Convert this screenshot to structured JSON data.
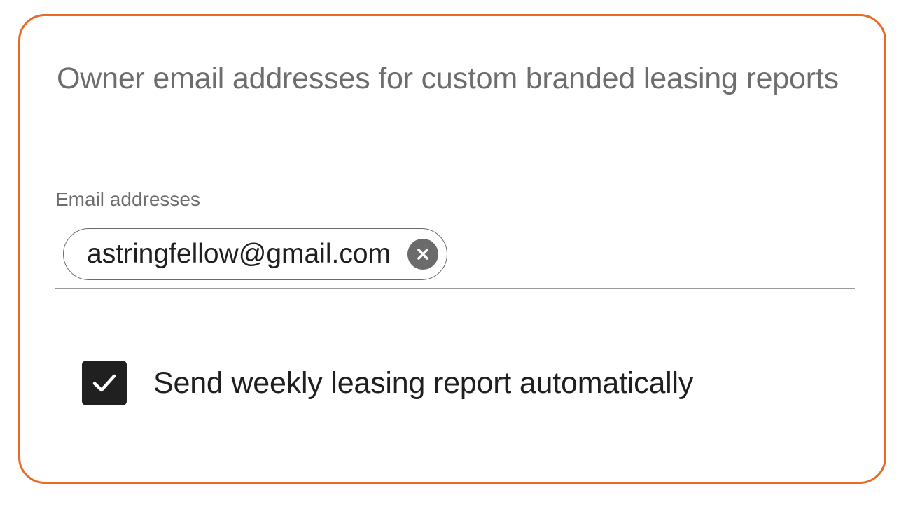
{
  "section": {
    "heading": "Owner email addresses for custom branded leasing reports",
    "accent_color": "#e86a24"
  },
  "email_field": {
    "label": "Email addresses",
    "chips": [
      {
        "value": "astringfellow@gmail.com",
        "remove_icon": "close-circle-icon"
      }
    ]
  },
  "weekly_report": {
    "label": "Send weekly leasing report automatically",
    "checked": true,
    "icon": "checkmark-icon"
  }
}
